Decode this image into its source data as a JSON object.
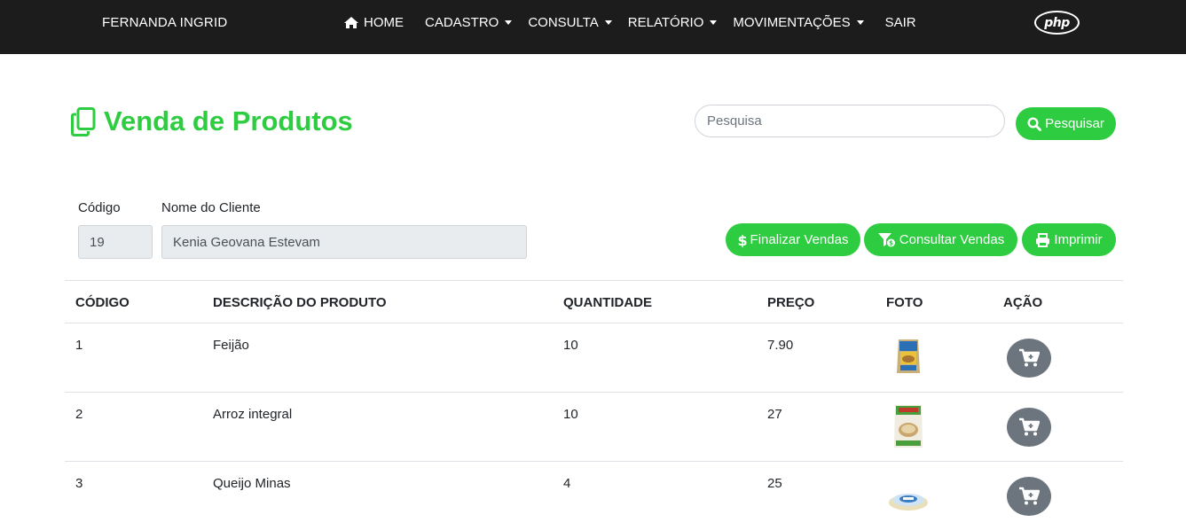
{
  "navbar": {
    "brand": "FERNANDA INGRID",
    "items": [
      {
        "label": "HOME",
        "icon": "home-icon",
        "dropdown": false
      },
      {
        "label": "CADASTRO",
        "dropdown": true
      },
      {
        "label": "CONSULTA",
        "dropdown": true
      },
      {
        "label": "RELATÓRIO",
        "dropdown": true
      },
      {
        "label": "MOVIMENTAÇÕES",
        "dropdown": true
      },
      {
        "label": "SAIR",
        "dropdown": false
      }
    ],
    "logo_text": "php"
  },
  "page": {
    "title": "Venda de Produtos",
    "title_icon": "copy-icon",
    "accent_color": "#2ecc40"
  },
  "search": {
    "placeholder": "Pesquisa",
    "value": "",
    "button_label": "Pesquisar"
  },
  "form": {
    "codigo_label": "Código",
    "codigo_value": "19",
    "cliente_label": "Nome do Cliente",
    "cliente_value": "Kenia Geovana Estevam"
  },
  "actions": {
    "finalizar_label": "Finalizar Vendas",
    "consultar_label": "Consultar Vendas",
    "imprimir_label": "Imprimir"
  },
  "table": {
    "headers": [
      "CÓDIGO",
      "DESCRIÇÃO DO PRODUTO",
      "QUANTIDADE",
      "PREÇO",
      "FOTO",
      "AÇÃO"
    ],
    "rows": [
      {
        "codigo": "1",
        "descricao": "Feijão",
        "quantidade": "10",
        "preco": "7.90",
        "foto": "feijao-package-image",
        "acao": "cart-plus-icon"
      },
      {
        "codigo": "2",
        "descricao": "Arroz integral",
        "quantidade": "10",
        "preco": "27",
        "foto": "arroz-package-image",
        "acao": "cart-plus-icon"
      },
      {
        "codigo": "3",
        "descricao": "Queijo Minas",
        "quantidade": "4",
        "preco": "25",
        "foto": "queijo-package-image",
        "acao": "cart-plus-icon"
      }
    ]
  }
}
